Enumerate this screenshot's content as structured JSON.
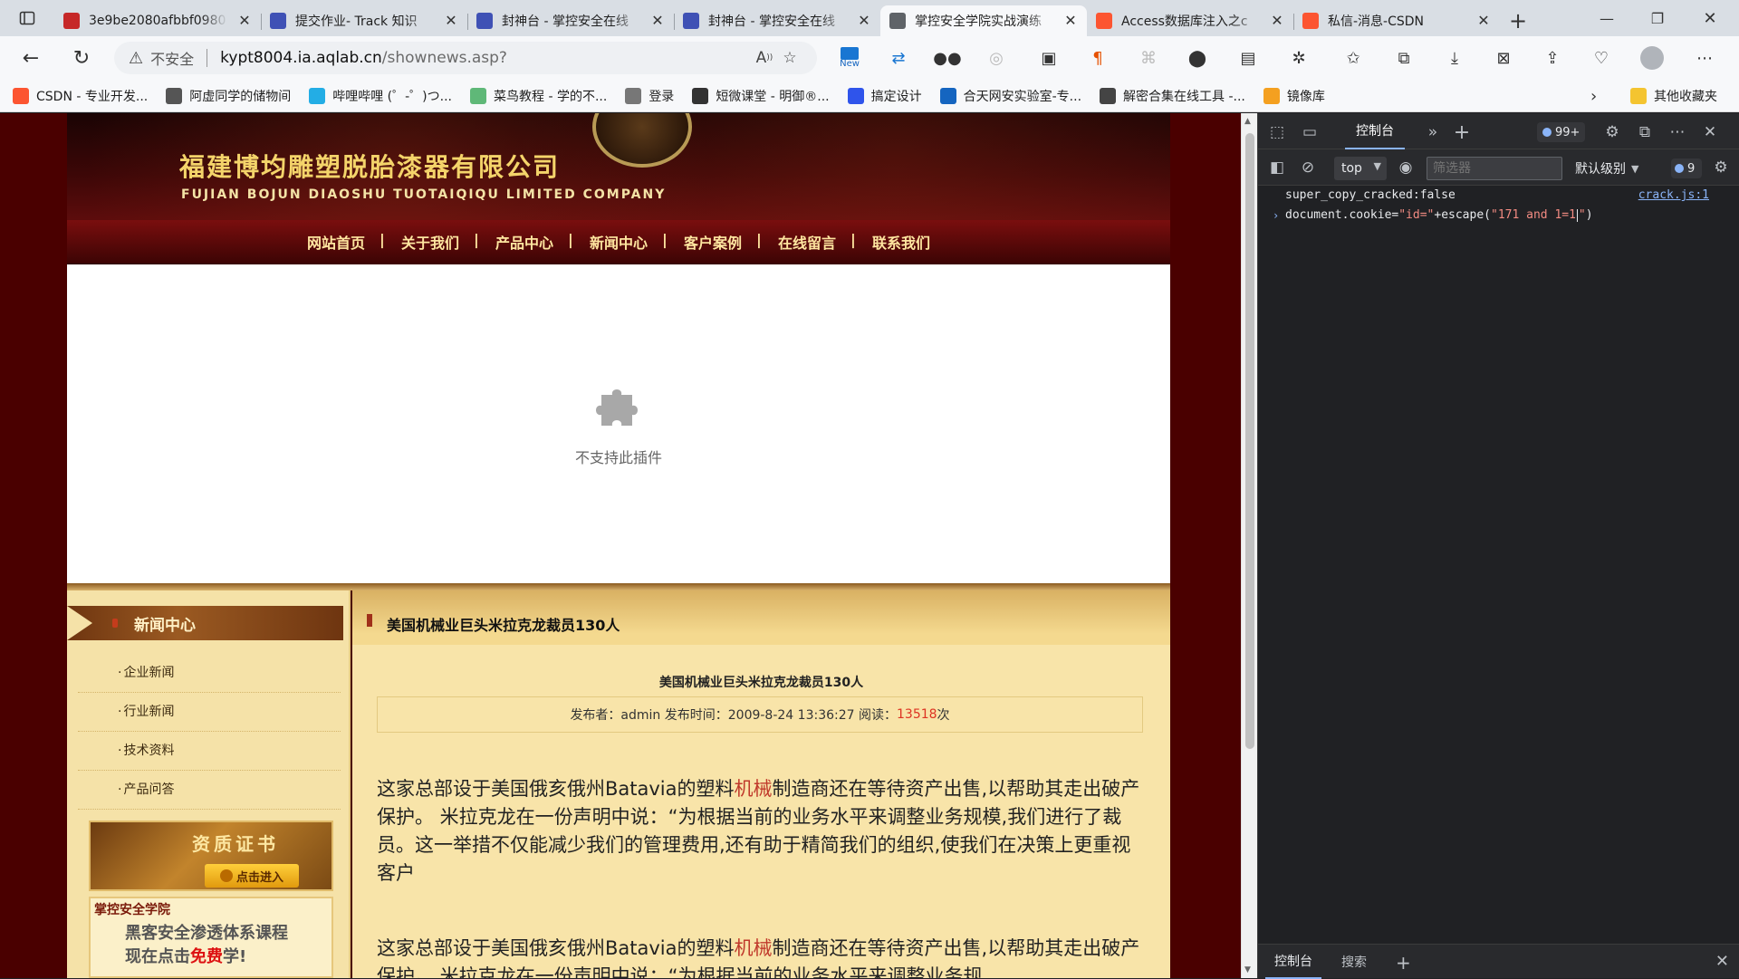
{
  "browser": {
    "tabs": [
      {
        "title": "3e9be2080afbbf0980",
        "favicon": "pdf-icon",
        "color": "#c62828",
        "active": false
      },
      {
        "title": "提交作业- Track 知识",
        "favicon": "shield-icon",
        "color": "#3f51b5",
        "active": false
      },
      {
        "title": "封神台 - 掌控安全在线",
        "favicon": "shield-icon",
        "color": "#3f51b5",
        "active": false
      },
      {
        "title": "封神台 - 掌控安全在线",
        "favicon": "shield-icon",
        "color": "#3f51b5",
        "active": false
      },
      {
        "title": "掌控安全学院实战演练",
        "favicon": "page-icon",
        "color": "#5f6368",
        "active": true
      },
      {
        "title": "Access数据库注入之c",
        "favicon": "csdn-icon",
        "color": "#fc5531",
        "active": false
      },
      {
        "title": "私信-消息-CSDN",
        "favicon": "csdn-icon",
        "color": "#fc5531",
        "active": false
      }
    ],
    "address": {
      "security_label": "不安全",
      "host": "kypt8004.ia.aqlab.cn",
      "path": "/shownews.asp?"
    },
    "extension_badge": "New",
    "bookmarks": [
      {
        "label": "CSDN - 专业开发...",
        "icon": "csdn-icon",
        "color": "#fc5531"
      },
      {
        "label": "阿虚同学的储物间",
        "icon": "avatar-icon",
        "color": "#555555"
      },
      {
        "label": "哔哩哔哩 (゜-゜)つ...",
        "icon": "bilibili-icon",
        "color": "#23ade5"
      },
      {
        "label": "菜鸟教程 - 学的不...",
        "icon": "runoob-icon",
        "color": "#5fb878"
      },
      {
        "label": "登录",
        "icon": "globe-icon",
        "color": "#777777"
      },
      {
        "label": "短微课堂 - 明御®...",
        "icon": "user-icon",
        "color": "#333333"
      },
      {
        "label": "搞定设计",
        "icon": "gd-icon",
        "color": "#2f54eb"
      },
      {
        "label": "合天网安实验室-专...",
        "icon": "shield-icon",
        "color": "#1565c0"
      },
      {
        "label": "解密合集在线工具 -...",
        "icon": "logo-icon",
        "color": "#444444"
      },
      {
        "label": "镜像库",
        "icon": "mirror-icon",
        "color": "#f4a020"
      }
    ],
    "other_bookmarks": "其他收藏夹"
  },
  "site": {
    "company_cn": "福建博均雕塑脱胎漆器有限公司",
    "company_en": "FUJIAN BOJUN DIAOSHU TUOTAIQIQU LIMITED COMPANY",
    "nav": [
      "网站首页",
      "关于我们",
      "产品中心",
      "新闻中心",
      "客户案例",
      "在线留言",
      "联系我们"
    ],
    "plugin_message": "不支持此插件",
    "sidebar": {
      "heading": "新闻中心",
      "items": [
        "企业新闻",
        "行业新闻",
        "技术资料",
        "产品问答"
      ],
      "promo_cert": {
        "label": "资质证书",
        "button": "点击进入"
      },
      "promo_course": {
        "brand": "掌控安全学院",
        "line1": "黑客安全渗透体系课程",
        "line2_pre": "现在点击",
        "line2_free": "免费",
        "line2_post": "学!"
      }
    },
    "article": {
      "section_title": "美国机械业巨头米拉克龙裁员130人",
      "title": "美国机械业巨头米拉克龙裁员130人",
      "meta_prefix": "发布者：admin 发布时间：2009-8-24 13:36:27 阅读：",
      "reads": "13518",
      "meta_suffix": "次",
      "para1_a": "这家总部设于美国俄亥俄州Batavia的塑料",
      "para1_hl": "机械",
      "para1_b": "制造商还在等待资产出售,以帮助其走出破产保护。 米拉克龙在一份声明中说：“为根据当前的业务水平来调整业务规模,我们进行了裁员。这一举措不仅能减少我们的管理费用,还有助于精简我们的组织,使我们在决策上更重视客户",
      "para2_a": "这家总部设于美国俄亥俄州Batavia的塑料",
      "para2_hl": "机械",
      "para2_b": "制造商还在等待资产出售,以帮助其走出破产保护。 米拉克龙在一份声明中说：“为根据当前的业务水平来调整业务规"
    }
  },
  "devtools": {
    "active_tab": "控制台",
    "issues_badge": "99+",
    "issues_badge_short": "9",
    "context": "top",
    "filter_placeholder": "筛选器",
    "level": "默认级别",
    "log": {
      "text": "super_copy_cracked:false",
      "source": "crack.js:1"
    },
    "input": {
      "pre": "document.cookie=",
      "str1": "\"id=\"",
      "mid": "+escape(",
      "str2a": "\"171 and 1=1",
      "str2b": "\"",
      "post": ")"
    },
    "drawer": {
      "console": "控制台",
      "search": "搜索"
    }
  }
}
